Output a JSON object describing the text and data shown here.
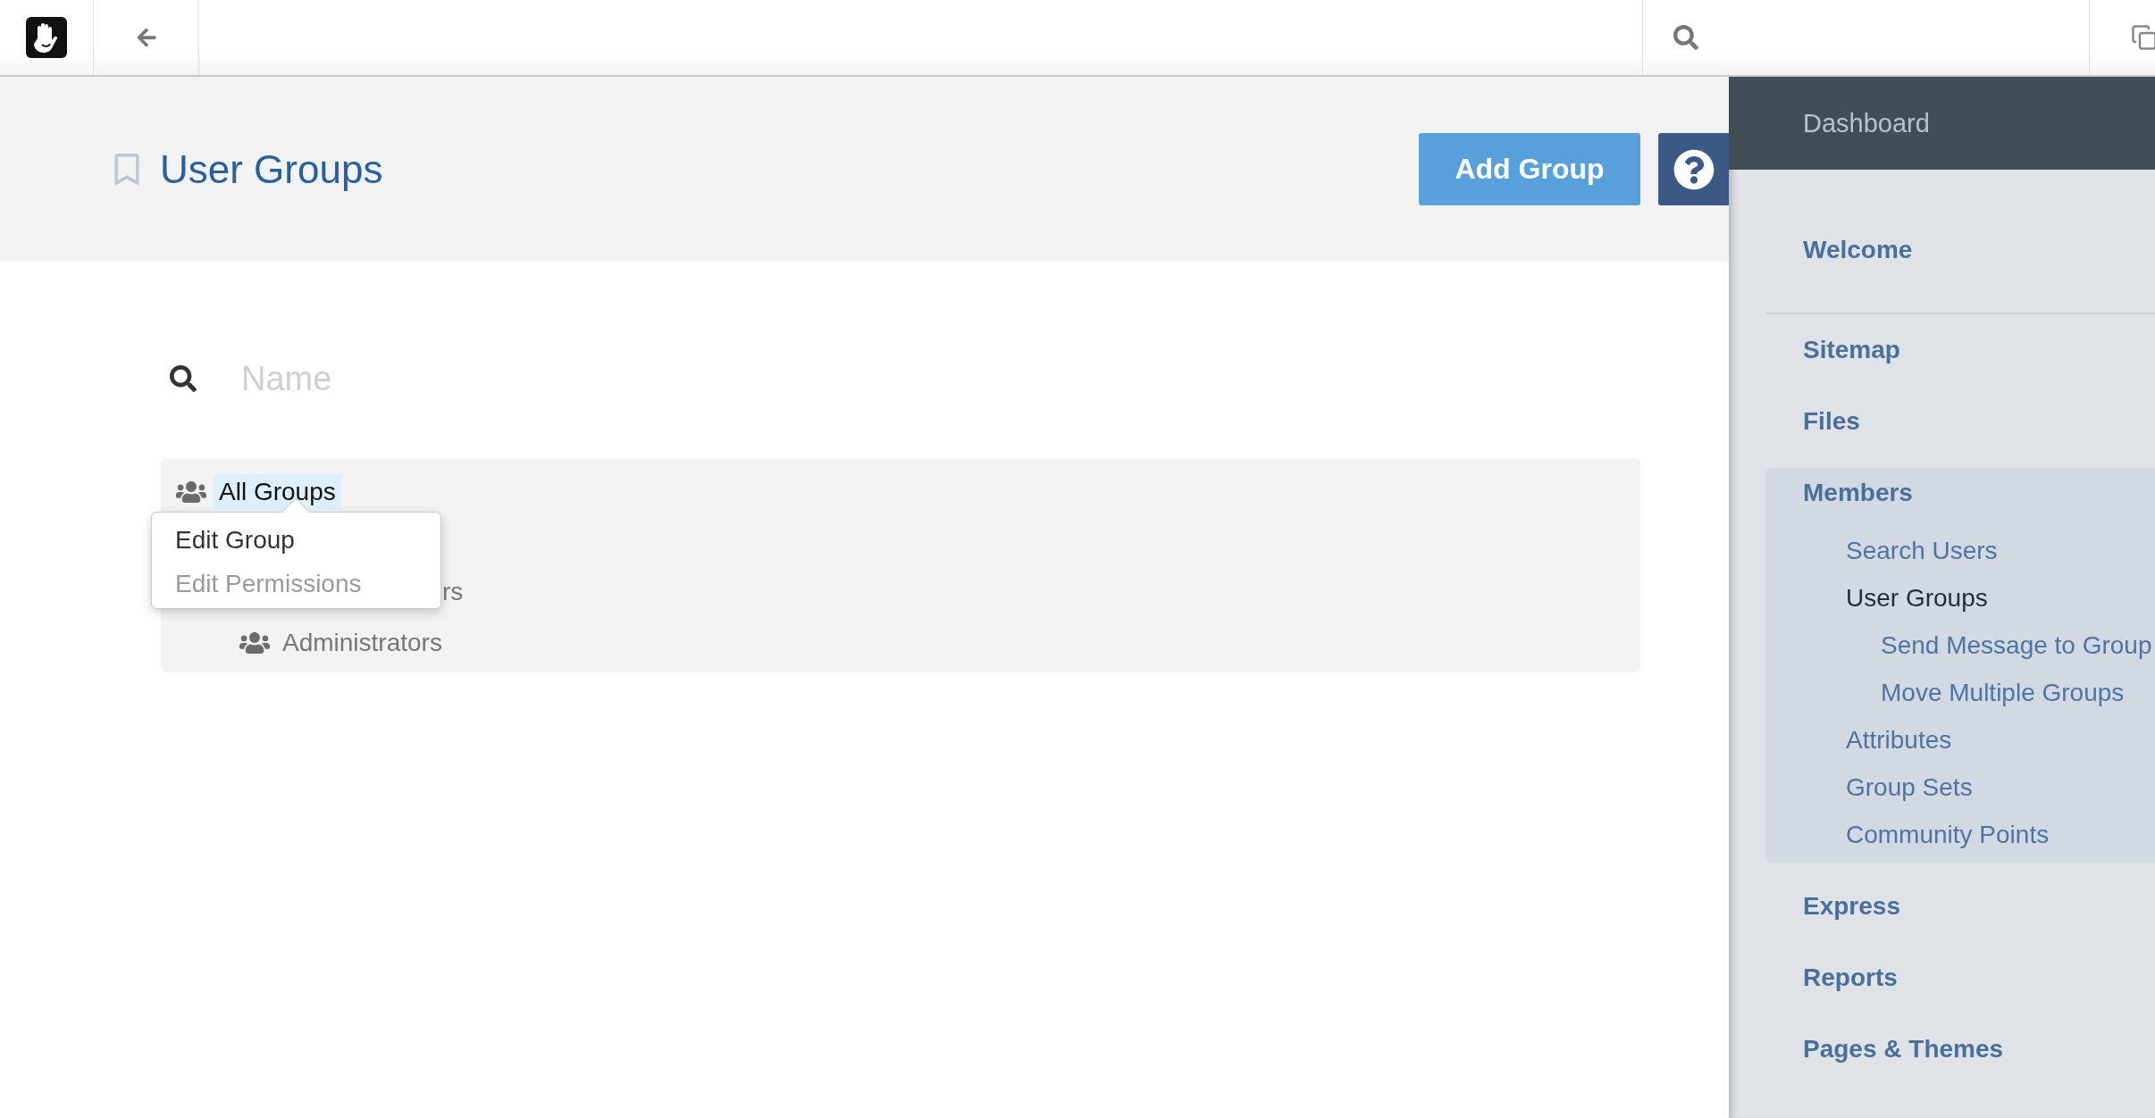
{
  "header": {
    "title": "User Groups",
    "add_button": "Add Group"
  },
  "search": {
    "placeholder": "Name"
  },
  "tree": [
    {
      "label": "All Groups",
      "selected": true,
      "kind": "node",
      "children": [
        {
          "label": "rs",
          "selected": false,
          "kind": "covered"
        },
        {
          "label": "Administrators",
          "selected": false,
          "kind": "node"
        }
      ]
    }
  ],
  "context_menu": {
    "items": [
      {
        "label": "Edit Group",
        "disabled": false
      },
      {
        "label": "Edit Permissions",
        "disabled": true
      }
    ]
  },
  "sidebar": {
    "title": "Dashboard",
    "sections": [
      [
        {
          "label": "Welcome",
          "selected": false,
          "kind": "link"
        }
      ],
      [
        {
          "label": "Sitemap",
          "selected": false,
          "kind": "link"
        },
        {
          "label": "Files",
          "selected": false,
          "kind": "link"
        },
        {
          "label": "Members",
          "selected": false,
          "kind": "group",
          "children": [
            {
              "label": "Search Users",
              "selected": false
            },
            {
              "label": "User Groups",
              "selected": true,
              "children": [
                {
                  "label": "Send Message to Group",
                  "selected": false
                },
                {
                  "label": "Move Multiple Groups",
                  "selected": false
                }
              ]
            },
            {
              "label": "Attributes",
              "selected": false
            },
            {
              "label": "Group Sets",
              "selected": false
            },
            {
              "label": "Community Points",
              "selected": false
            }
          ]
        },
        {
          "label": "Express",
          "selected": false,
          "kind": "link"
        },
        {
          "label": "Reports",
          "selected": false,
          "kind": "link"
        },
        {
          "label": "Pages & Themes",
          "selected": false,
          "kind": "link"
        }
      ]
    ]
  }
}
